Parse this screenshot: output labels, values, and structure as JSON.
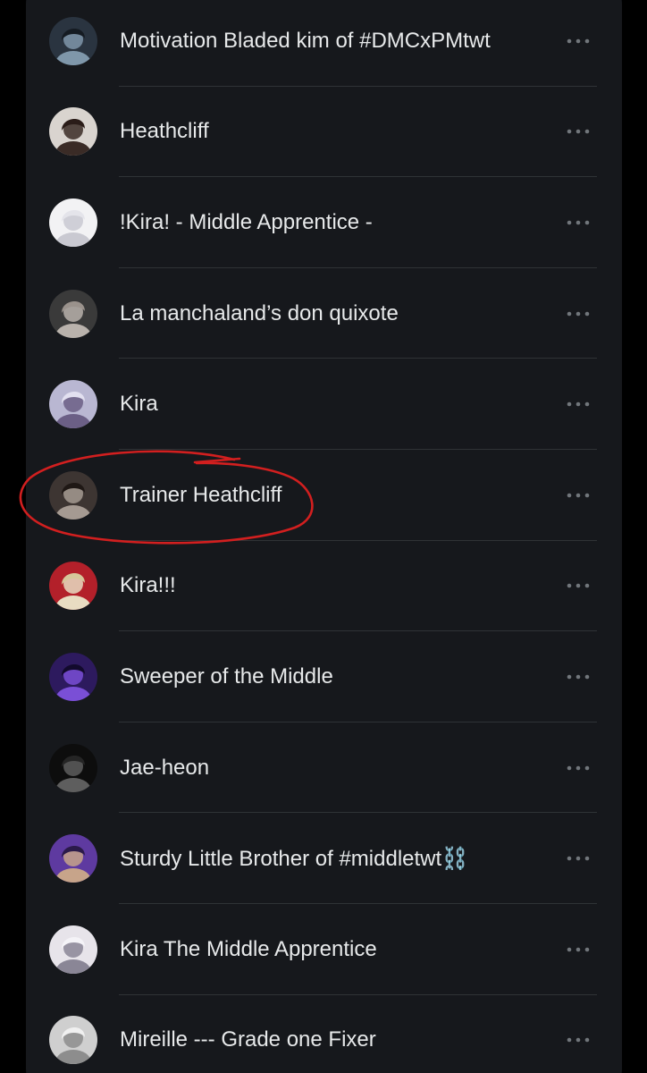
{
  "list": {
    "items": [
      {
        "name": "Motivation Bladed kim of #DMCxPMtwt",
        "avatar": {
          "bg": "#2a3440",
          "fg": "#7f97aa",
          "hair": "#151b22"
        }
      },
      {
        "name": "Heathcliff",
        "avatar": {
          "bg": "#d9d4cf",
          "fg": "#3a2b26",
          "hair": "#2a1c18"
        }
      },
      {
        "name": "!Kira! - Middle Apprentice -",
        "avatar": {
          "bg": "#f2f2f4",
          "fg": "#c9c9d1",
          "hair": "#e4e4ea"
        }
      },
      {
        "name": "La manchaland’s don quixote",
        "avatar": {
          "bg": "#3a3a3a",
          "fg": "#b9b2ac",
          "hair": "#9a928c"
        }
      },
      {
        "name": "Kira",
        "avatar": {
          "bg": "#b9b7d2",
          "fg": "#6b5f86",
          "hair": "#e2e0f0"
        }
      },
      {
        "name": "Trainer Heathcliff",
        "avatar": {
          "bg": "#3d3532",
          "fg": "#a59a92",
          "hair": "#1f1815"
        }
      },
      {
        "name": "Kira!!!",
        "avatar": {
          "bg": "#b3202a",
          "fg": "#e8dcc2",
          "hair": "#d6c79a"
        }
      },
      {
        "name": "Sweeper of the Middle",
        "avatar": {
          "bg": "#2d1a5e",
          "fg": "#7a4fd6",
          "hair": "#120a2c"
        }
      },
      {
        "name": "Jae-heon",
        "avatar": {
          "bg": "#0d0d0d",
          "fg": "#5e5e5e",
          "hair": "#252525"
        }
      },
      {
        "name": "Sturdy Little Brother of #middletwt⛓️",
        "avatar": {
          "bg": "#5e3aa0",
          "fg": "#c7a48a",
          "hair": "#2b1a4a"
        }
      },
      {
        "name": "Kira The Middle Apprentice",
        "avatar": {
          "bg": "#e7e4ea",
          "fg": "#8a8696",
          "hair": "#f4f3f7"
        }
      },
      {
        "name": "Mireille --- Grade one Fixer",
        "avatar": {
          "bg": "#cfcfcf",
          "fg": "#8d8d8d",
          "hair": "#f0f0f0"
        }
      }
    ]
  },
  "more_icon": "more-horizontal-icon",
  "annotation": {
    "color": "#d21f1f",
    "target_index": 5
  }
}
